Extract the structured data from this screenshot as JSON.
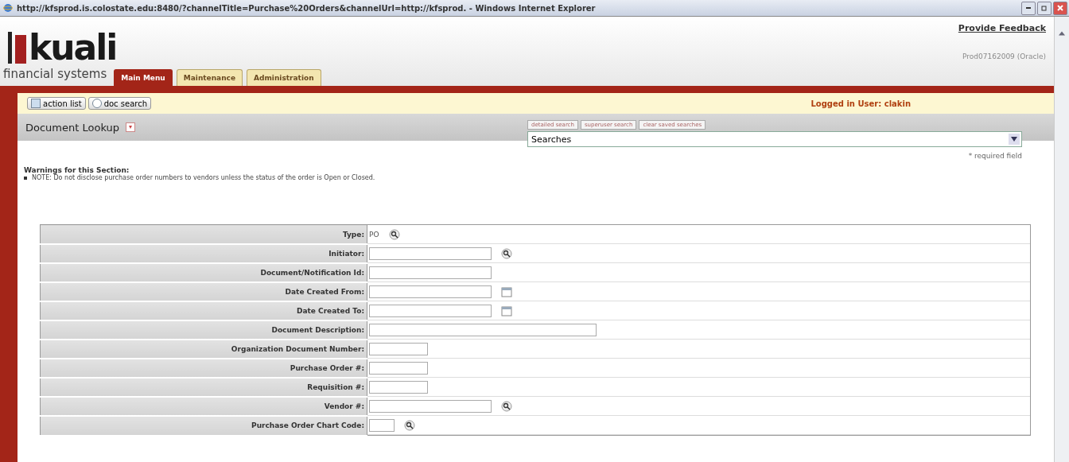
{
  "window": {
    "title": "http://kfsprod.is.colostate.edu:8480/?channelTitle=Purchase%20Orders&channelUrl=http://kfsprod. - Windows Internet Explorer"
  },
  "header": {
    "logo": "kuali",
    "tagline": "financial systems",
    "feedback_link": "Provide Feedback",
    "environment": "Prod07162009 (Oracle)"
  },
  "tabs": [
    {
      "label": "Main Menu",
      "selected": true
    },
    {
      "label": "Maintenance",
      "selected": false
    },
    {
      "label": "Administration",
      "selected": false
    }
  ],
  "toolbar": {
    "buttons": [
      "action list",
      "doc search"
    ],
    "logged_in": "Logged in User: clakin"
  },
  "lookup": {
    "title": "Document Lookup",
    "search_buttons": [
      "detailed search",
      "superuser search",
      "clear saved searches"
    ],
    "searches_select": "Searches",
    "required_note": "* required field"
  },
  "warnings": {
    "title": "Warnings for this Section:",
    "items": [
      "NOTE: Do not disclose purchase order numbers to vendors unless the status of the order is Open or Closed."
    ]
  },
  "fields": [
    {
      "label": "Type:",
      "kind": "readonly",
      "value": "PO",
      "lookup": true
    },
    {
      "label": "Initiator:",
      "kind": "medium",
      "lookup": true
    },
    {
      "label": "Document/Notification Id:",
      "kind": "medium"
    },
    {
      "label": "Date Created From:",
      "kind": "medium",
      "calendar": true
    },
    {
      "label": "Date Created To:",
      "kind": "medium",
      "calendar": true
    },
    {
      "label": "Document Description:",
      "kind": "long"
    },
    {
      "label": "Organization Document Number:",
      "kind": "short"
    },
    {
      "label": "Purchase Order #:",
      "kind": "short"
    },
    {
      "label": "Requisition #:",
      "kind": "short"
    },
    {
      "label": "Vendor #:",
      "kind": "medium",
      "lookup": true
    },
    {
      "label": "Purchase Order Chart Code:",
      "kind": "tiny",
      "lookup": true
    }
  ]
}
